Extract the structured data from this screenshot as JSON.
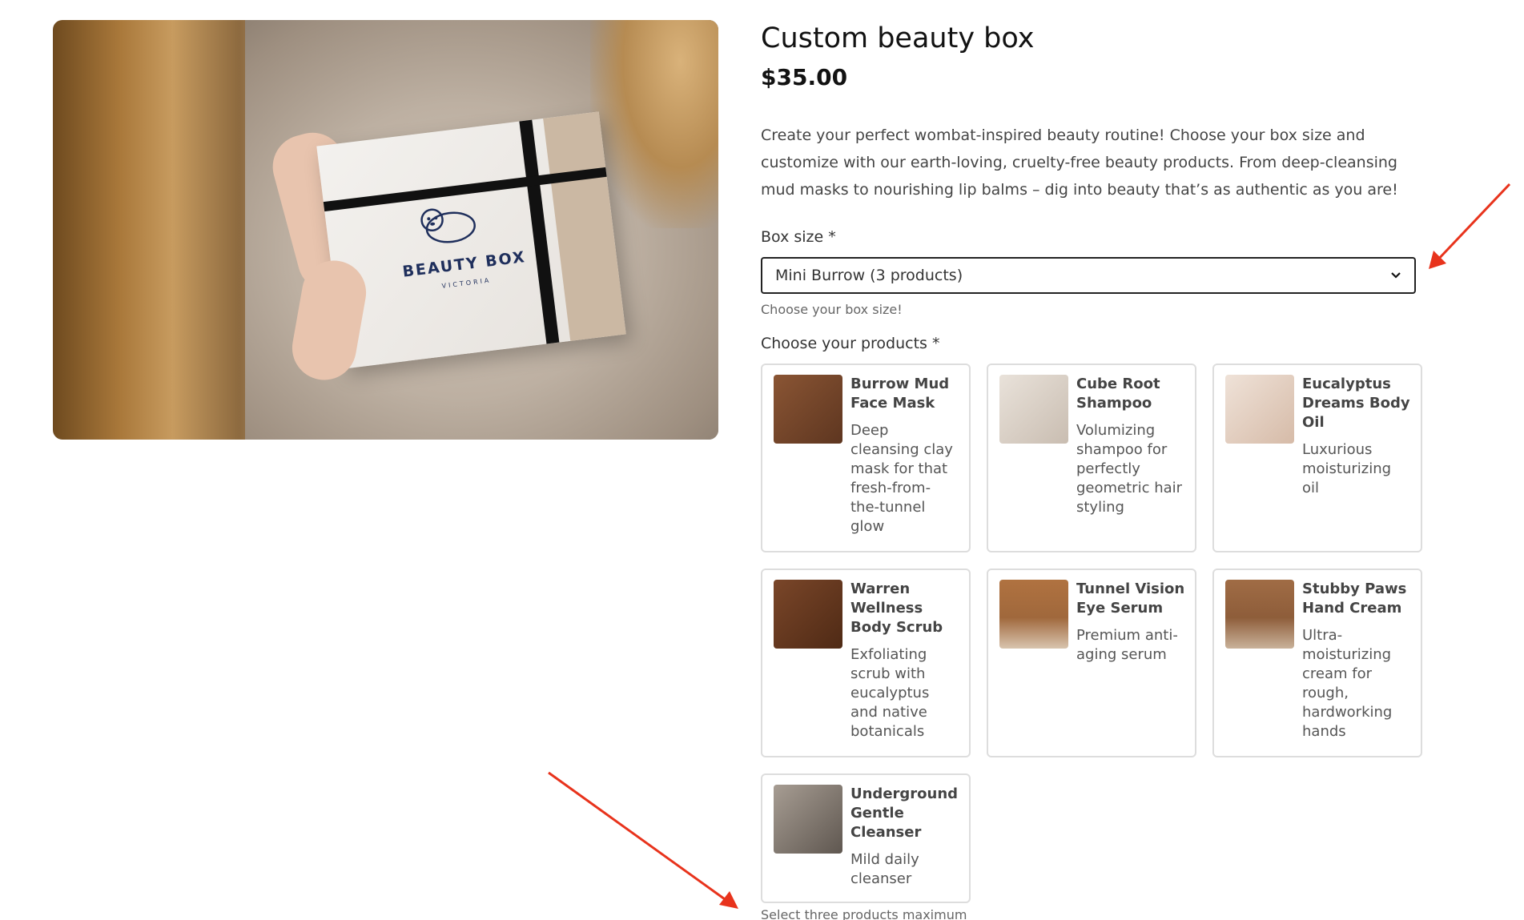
{
  "product": {
    "title": "Custom beauty box",
    "price": "$35.00",
    "description": "Create your perfect wombat-inspired beauty routine! Choose your box size and customize with our earth-loving, cruelty-free beauty products. From deep-cleansing mud masks to nourishing lip balms – dig into beauty that’s as authentic as you are!",
    "image": {
      "box_brand": "BEAUTY BOX",
      "box_sub": "VICTORIA"
    }
  },
  "box_size": {
    "label": "Box size *",
    "selected": "Mini Burrow (3 products)",
    "help": "Choose your box size!"
  },
  "products_section": {
    "label": "Choose your products *",
    "help": "Select three products maximum",
    "items": [
      {
        "name": "Burrow Mud Face Mask",
        "description": "Deep cleansing clay mask for that fresh-from-the-tunnel glow",
        "thumb_color": "#7a4a2c"
      },
      {
        "name": "Cube Root Shampoo",
        "description": "Volumizing shampoo for perfectly geometric hair styling",
        "thumb_color": "#d8cfc6"
      },
      {
        "name": "Eucalyptus Dreams Body Oil",
        "description": "Luxurious moisturizing oil",
        "thumb_color": "#e0cfc2"
      },
      {
        "name": "Warren Wellness Body Scrub",
        "description": "Exfoliating scrub with eucalyptus and native botanicals",
        "thumb_color": "#6d3f24"
      },
      {
        "name": "Tunnel Vision Eye Serum",
        "description": "Premium anti-aging serum",
        "thumb_color": "#a0683c"
      },
      {
        "name": "Stubby Paws Hand Cream",
        "description": "Ultra-moisturizing cream for rough, hardworking hands",
        "thumb_color": "#9c6a45"
      },
      {
        "name": "Underground Gentle Cleanser",
        "description": "Mild daily cleanser",
        "thumb_color": "#8a8078"
      }
    ]
  },
  "colors": {
    "accent_arrow": "#e8331c",
    "border": "#dddddd",
    "text_dark": "#121212"
  }
}
